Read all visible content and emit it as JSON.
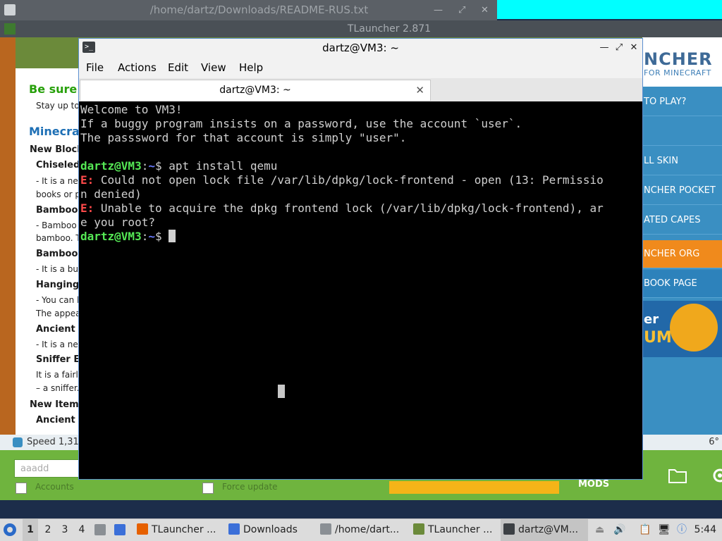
{
  "bg_editor": {
    "title": "/home/dartz/Downloads/README-RUS.txt"
  },
  "tlauncher": {
    "window_title": "TLauncher 2.871",
    "logo": "NCHER",
    "logo_sub": "FOR MINECRAFT",
    "news_lines": [
      {
        "text": "Be sure t",
        "style": "green"
      },
      {
        "text": "Stay up to",
        "style": "normal"
      },
      {
        "text": "Minecraf",
        "style": "blue"
      },
      {
        "text": "New Blocks",
        "style": "heading"
      },
      {
        "text": "Chiseled",
        "style": "heading"
      },
      {
        "text": "- It is a new",
        "style": "normal"
      },
      {
        "text": "books or p",
        "style": "normal"
      },
      {
        "text": "Bamboo P",
        "style": "heading"
      },
      {
        "text": "- Bamboo p",
        "style": "normal"
      },
      {
        "text": "bamboo. T",
        "style": "normal"
      },
      {
        "text": "Bamboo I",
        "style": "heading"
      },
      {
        "text": "- It is a buil",
        "style": "normal"
      },
      {
        "text": "Hanging S",
        "style": "heading"
      },
      {
        "text": "- You can le",
        "style": "normal"
      },
      {
        "text": "The appear",
        "style": "normal"
      },
      {
        "text": "Ancient P",
        "style": "heading"
      },
      {
        "text": "- It is a new",
        "style": "normal"
      },
      {
        "text": "Sniffer Eg",
        "style": "heading"
      },
      {
        "text": "It is a fairly",
        "style": "normal"
      },
      {
        "text": "– a sniffer.",
        "style": "normal"
      },
      {
        "text": "New Items",
        "style": "heading"
      },
      {
        "text": "Ancient S",
        "style": "heading"
      }
    ],
    "side_buttons": [
      {
        "label": "TO PLAY?",
        "style": "blue"
      },
      {
        "label": "",
        "style": "blue"
      },
      {
        "label": "LL SKIN",
        "style": "blue"
      },
      {
        "label": "NCHER POCKET",
        "style": "blue"
      },
      {
        "label": "ATED CAPES",
        "style": "blue"
      },
      {
        "label": "NCHER ORG",
        "style": "orange"
      },
      {
        "label": "BOOK PAGE",
        "style": "blue2"
      }
    ],
    "promo_text1": "er",
    "promo_text2": "UM",
    "status_speed": "Speed 1,31",
    "status_percent": "6°",
    "username_value": "aaadd",
    "accounts_label": "Accounts",
    "force_update_label": "Force update",
    "mods_label": "MODS"
  },
  "terminal": {
    "window_title": "dartz@VM3: ~",
    "menu": [
      "File",
      "Actions",
      "Edit",
      "View",
      "Help"
    ],
    "tab_title": "dartz@VM3: ~",
    "motd": [
      "Welcome to VM3!",
      "If a buggy program insists on a password, use the account `user`.",
      "The passsword for that account is simply \"user\"."
    ],
    "prompt_user": "dartz@VM3",
    "prompt_path": "~",
    "prompt_sign": "$ ",
    "command": "apt install qemu",
    "error_prefix": "E:",
    "error1_l1": " Could not open lock file /var/lib/dpkg/lock-frontend - open (13: Permissio",
    "error1_l2": "n denied)",
    "error2_l1": " Unable to acquire the dpkg frontend lock (/var/lib/dpkg/lock-frontend), ar",
    "error2_l2": "e you root?"
  },
  "taskbar": {
    "workspaces": [
      "1",
      "2",
      "3",
      "4"
    ],
    "active_workspace": "1",
    "items": [
      {
        "label": "TLauncher ...",
        "icon": "firefox-icon",
        "color": "#e66000"
      },
      {
        "label": "Downloads",
        "icon": "folder-icon",
        "color": "#3b6fd8"
      },
      {
        "label": "/home/dart...",
        "icon": "text-editor-icon",
        "color": "#8a8f94"
      },
      {
        "label": "TLauncher ...",
        "icon": "minecraft-icon",
        "color": "#6b8a3a"
      },
      {
        "label": "dartz@VM...",
        "icon": "terminal-icon",
        "color": "#3c4044"
      }
    ],
    "clock": "5:44"
  }
}
